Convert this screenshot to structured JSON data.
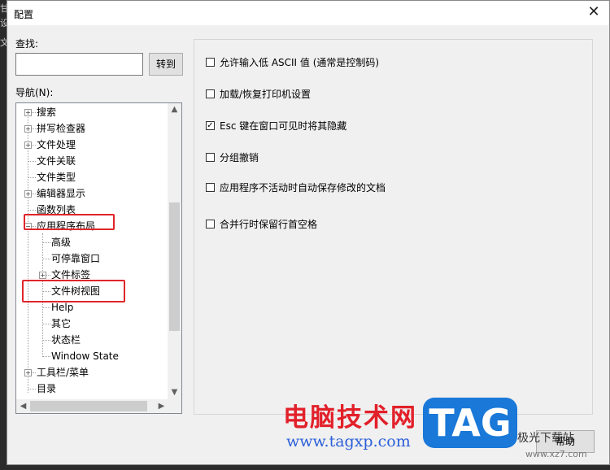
{
  "background_fragments": [
    "甘",
    "设",
    "文"
  ],
  "dialog": {
    "title": "配置",
    "close_glyph": "✕"
  },
  "search": {
    "label": "查找:",
    "value": "",
    "placeholder": "",
    "goto_label": "转到"
  },
  "navigation": {
    "label": "导航(N):",
    "items": [
      {
        "label": "搜索",
        "expander": "+"
      },
      {
        "label": "拼写检查器",
        "expander": "+"
      },
      {
        "label": "文件处理",
        "expander": "+"
      },
      {
        "label": "文件关联",
        "expander": ""
      },
      {
        "label": "文件类型",
        "expander": ""
      },
      {
        "label": "编辑器显示",
        "expander": "+"
      },
      {
        "label": "函数列表",
        "expander": ""
      },
      {
        "label": "应用程序布局",
        "expander": "−"
      },
      {
        "label": "高级",
        "expander": ""
      },
      {
        "label": "可停靠窗口",
        "expander": ""
      },
      {
        "label": "文件标签",
        "expander": "+"
      },
      {
        "label": "文件树视图",
        "expander": ""
      },
      {
        "label": "Help",
        "expander": ""
      },
      {
        "label": "其它",
        "expander": ""
      },
      {
        "label": "状态栏",
        "expander": ""
      },
      {
        "label": "Window State",
        "expander": ""
      },
      {
        "label": "工具栏/菜单",
        "expander": "+"
      },
      {
        "label": "目录",
        "expander": ""
      }
    ],
    "scroll_up": "▲",
    "scroll_down": "▼",
    "scroll_left": "◀",
    "scroll_right": "▶"
  },
  "options": [
    {
      "label": "允许输入低 ASCII 值 (通常是控制码)",
      "checked": false
    },
    {
      "label": "加载/恢复打印机设置",
      "checked": false
    },
    {
      "label": "Esc 键在窗口可见时将其隐藏",
      "checked": true
    },
    {
      "label": "分组撤销",
      "checked": false
    },
    {
      "label": "应用程序不活动时自动保存修改的文档",
      "checked": false
    },
    {
      "label": "合并行时保留行首空格",
      "checked": false
    }
  ],
  "check_glyph": "✓",
  "help_label": "帮助",
  "watermark": {
    "title": "电脑技术网",
    "url": "www.tagxp.com",
    "logo": "TAG",
    "site": "极光下载站",
    "site_url": "www.xz7.com"
  },
  "colors": {
    "highlight": "#e0252b",
    "watermark_red": "#e2202a",
    "watermark_blue": "#1978d8"
  }
}
